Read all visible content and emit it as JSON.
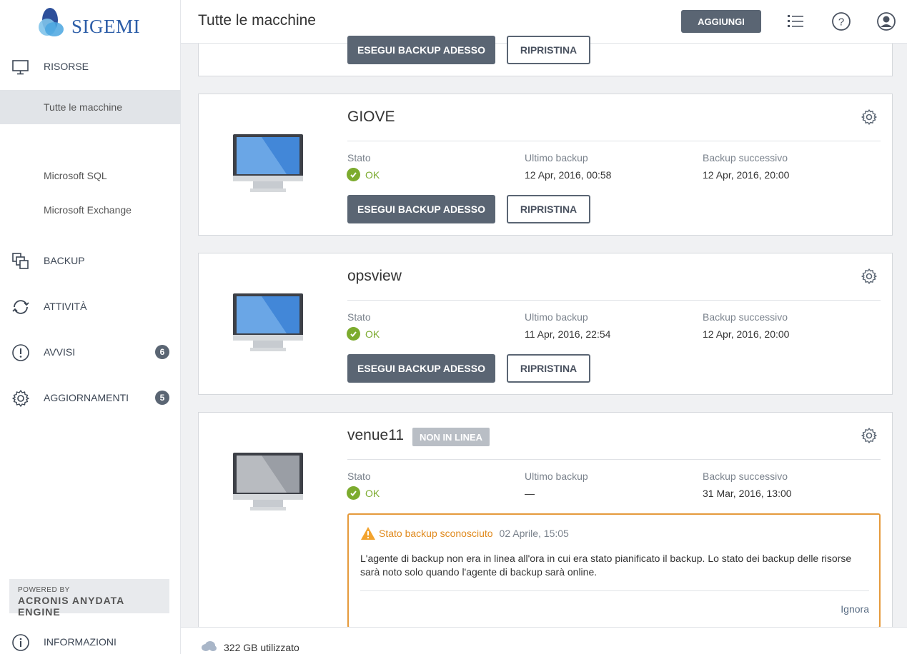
{
  "brand": {
    "logo_text": "SIGEMI"
  },
  "sidebar": {
    "risorse": "RISORSE",
    "tutte_le_macchine": "Tutte le macchine",
    "microsoft_sql": "Microsoft SQL",
    "microsoft_exchange": "Microsoft Exchange",
    "backup": "BACKUP",
    "attivita": "ATTIVITÀ",
    "avvisi": "AVVISI",
    "avvisi_count": "6",
    "aggiornamenti": "AGGIORNAMENTI",
    "aggiornamenti_count": "5",
    "informazioni": "INFORMAZIONI",
    "powered_by": "POWERED BY",
    "engine": "ACRONIS ANYDATA ENGINE"
  },
  "header": {
    "title": "Tutte le macchine",
    "add_label": "AGGIUNGI"
  },
  "labels": {
    "stato": "Stato",
    "ultimo_backup": "Ultimo backup",
    "backup_successivo": "Backup successivo",
    "backup_now": "ESEGUI BACKUP ADESSO",
    "restore": "RIPRISTINA"
  },
  "machines": [
    {
      "name": "GIOVE",
      "status": "OK",
      "last_backup": "12 Apr, 2016, 00:58",
      "next_backup": "12 Apr, 2016, 20:00"
    },
    {
      "name": "opsview",
      "status": "OK",
      "last_backup": "11 Apr, 2016, 22:54",
      "next_backup": "12 Apr, 2016, 20:00"
    },
    {
      "name": "venue11",
      "badge": "NON IN LINEA",
      "status": "OK",
      "last_backup": "—",
      "next_backup": "31 Mar, 2016, 13:00",
      "alert": {
        "title": "Stato backup sconosciuto",
        "date": "02 Aprile, 15:05",
        "body": "L'agente di backup non era in linea all'ora in cui era stato pianificato il backup. Lo stato dei backup delle risorse sarà noto solo quando l'agente di backup sarà online.",
        "action": "Ignora"
      }
    }
  ],
  "footer": {
    "usage": "322 GB utilizzato"
  },
  "colors": {
    "accent": "#5a6573",
    "ok": "#7cab2e",
    "warning": "#e59a3c",
    "monitor_screen": "#3a7fd5",
    "monitor_offline": "#9a9ea5"
  }
}
